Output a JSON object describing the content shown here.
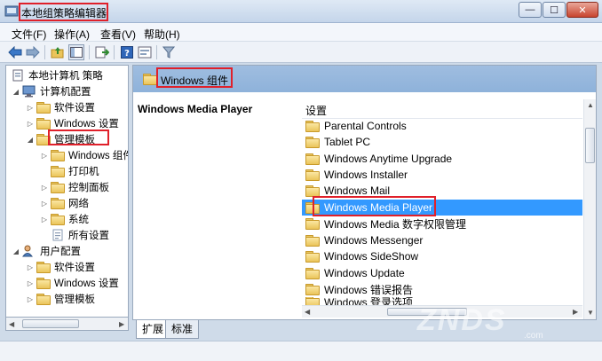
{
  "window": {
    "title": "本地组策略编辑器",
    "buttons": {
      "minimize": "—",
      "maximize": "☐",
      "close": "✕"
    }
  },
  "menu": [
    "文件(F)",
    "操作(A)",
    "查看(V)",
    "帮助(H)"
  ],
  "toolbar_icons": [
    "back-arrow-icon",
    "forward-arrow-icon",
    "up-folder-icon",
    "show-hide-tree-icon",
    "export-list-icon",
    "help-icon",
    "properties-icon",
    "filter-icon"
  ],
  "tree": {
    "root": "本地计算机 策略",
    "computer_config": "计算机配置",
    "cc_software": "软件设置",
    "cc_windows": "Windows 设置",
    "cc_admin": "管理模板",
    "admin_children": [
      "Windows 组件",
      "打印机",
      "控制面板",
      "网络",
      "系统",
      "所有设置"
    ],
    "user_config": "用户配置",
    "uc_software": "软件设置",
    "uc_windows": "Windows 设置",
    "uc_admin": "管理模板"
  },
  "right": {
    "header": "Windows 组件",
    "selected_title": "Windows Media Player",
    "column_header": "设置",
    "items": [
      "Parental Controls",
      "Tablet PC",
      "Windows Anytime Upgrade",
      "Windows Installer",
      "Windows Mail",
      "Windows Media Player",
      "Windows Media 数字权限管理",
      "Windows Messenger",
      "Windows SideShow",
      "Windows Update",
      "Windows 错误报告",
      "Windows 登录选项"
    ],
    "selected_index": 5
  },
  "tabs": {
    "extended": "扩展",
    "standard": "标准"
  },
  "watermark": {
    "main": "ZNDS",
    "sub": ".com"
  },
  "colors": {
    "selection": "#3399ff",
    "highlight_box": "#e0202a",
    "header_bg": "#9fbde0"
  }
}
